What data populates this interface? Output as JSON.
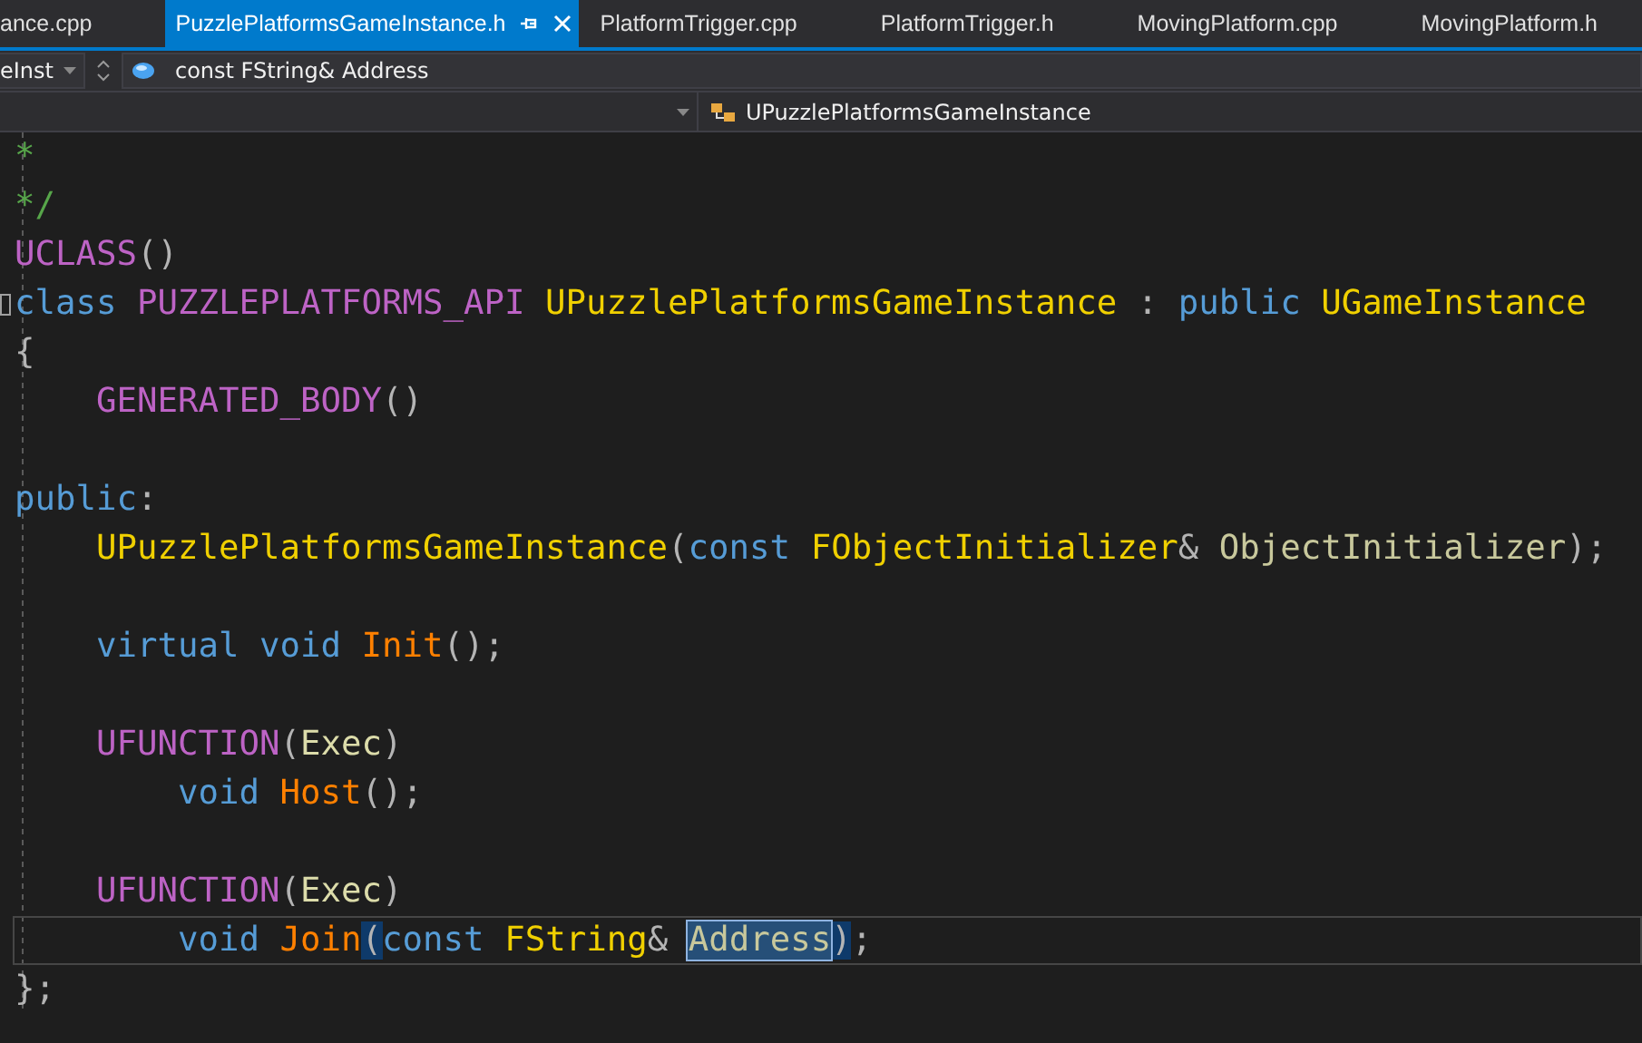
{
  "tabs": [
    {
      "label": "ance.cpp",
      "selected": false
    },
    {
      "label": "PuzzlePlatformsGameInstance.h",
      "selected": true
    },
    {
      "label": "PlatformTrigger.cpp",
      "selected": false
    },
    {
      "label": "PlatformTrigger.h",
      "selected": false
    },
    {
      "label": "MovingPlatform.cpp",
      "selected": false
    },
    {
      "label": "MovingPlatform.h",
      "selected": false
    }
  ],
  "navigation": {
    "project_dropdown": "eInst",
    "member_field": "const FString& Address",
    "scope_dropdown": "UPuzzlePlatformsGameInstance"
  },
  "lines": [
    {
      "kind": "code",
      "current": false,
      "fold": false,
      "tokens": [
        {
          "text": "*",
          "kind": "comment"
        }
      ]
    },
    {
      "kind": "code",
      "current": false,
      "fold": false,
      "tokens": [
        {
          "text": "*/",
          "kind": "comment"
        }
      ]
    },
    {
      "kind": "code",
      "current": false,
      "fold": false,
      "tokens": [
        {
          "text": "UCLASS",
          "kind": "macro"
        },
        {
          "text": "()",
          "kind": "punct"
        }
      ]
    },
    {
      "kind": "code",
      "current": false,
      "fold": true,
      "tokens": [
        {
          "text": "class ",
          "kind": "keyword"
        },
        {
          "text": "PUZZLEPLATFORMS_API ",
          "kind": "macro"
        },
        {
          "text": "UPuzzlePlatformsGameInstance ",
          "kind": "type"
        },
        {
          "text": ": ",
          "kind": "punct"
        },
        {
          "text": "public ",
          "kind": "keyword"
        },
        {
          "text": "UGameInstance",
          "kind": "type"
        }
      ]
    },
    {
      "kind": "code",
      "current": false,
      "fold": false,
      "tokens": [
        {
          "text": "{",
          "kind": "punct"
        }
      ]
    },
    {
      "kind": "code",
      "current": false,
      "fold": false,
      "tokens": [
        {
          "text": "    GENERATED_BODY",
          "kind": "macro"
        },
        {
          "text": "()",
          "kind": "punct"
        }
      ]
    },
    {
      "kind": "blank",
      "current": false,
      "fold": false
    },
    {
      "kind": "code",
      "current": false,
      "fold": false,
      "tokens": [
        {
          "text": "public",
          "kind": "keyword"
        },
        {
          "text": ":",
          "kind": "punct"
        }
      ]
    },
    {
      "kind": "code",
      "current": false,
      "fold": false,
      "tokens": [
        {
          "text": "    UPuzzlePlatformsGameInstance",
          "kind": "type"
        },
        {
          "text": "(",
          "kind": "punct"
        },
        {
          "text": "const ",
          "kind": "keyword"
        },
        {
          "text": "FObjectInitializer",
          "kind": "type"
        },
        {
          "text": "& ",
          "kind": "punct"
        },
        {
          "text": "ObjectInitializer",
          "kind": "param"
        },
        {
          "text": ");",
          "kind": "punct"
        }
      ]
    },
    {
      "kind": "blank",
      "current": false,
      "fold": false
    },
    {
      "kind": "code",
      "current": false,
      "fold": false,
      "tokens": [
        {
          "text": "    virtual void ",
          "kind": "keyword"
        },
        {
          "text": "Init",
          "kind": "function"
        },
        {
          "text": "();",
          "kind": "punct"
        }
      ]
    },
    {
      "kind": "blank",
      "current": false,
      "fold": false
    },
    {
      "kind": "code",
      "current": false,
      "fold": false,
      "tokens": [
        {
          "text": "    UFUNCTION",
          "kind": "macro"
        },
        {
          "text": "(",
          "kind": "punct"
        },
        {
          "text": "Exec",
          "kind": "argument"
        },
        {
          "text": ")",
          "kind": "punct"
        }
      ]
    },
    {
      "kind": "code",
      "current": false,
      "fold": false,
      "tokens": [
        {
          "text": "        void ",
          "kind": "keyword"
        },
        {
          "text": "Host",
          "kind": "function"
        },
        {
          "text": "();",
          "kind": "punct"
        }
      ]
    },
    {
      "kind": "blank",
      "current": false,
      "fold": false
    },
    {
      "kind": "code",
      "current": false,
      "fold": false,
      "tokens": [
        {
          "text": "    UFUNCTION",
          "kind": "macro"
        },
        {
          "text": "(",
          "kind": "punct"
        },
        {
          "text": "Exec",
          "kind": "argument"
        },
        {
          "text": ")",
          "kind": "punct"
        }
      ]
    },
    {
      "kind": "code",
      "current": true,
      "fold": false,
      "tokens": [
        {
          "text": "        void ",
          "kind": "keyword"
        },
        {
          "text": "Join",
          "kind": "function"
        },
        {
          "text": "(",
          "kind": "paren-match"
        },
        {
          "text": "const ",
          "kind": "keyword"
        },
        {
          "text": "FString",
          "kind": "type"
        },
        {
          "text": "& ",
          "kind": "punct"
        },
        {
          "text": "Address",
          "kind": "selected-param"
        },
        {
          "text": ")",
          "kind": "paren-match"
        },
        {
          "text": ";",
          "kind": "punct"
        }
      ]
    },
    {
      "kind": "code",
      "current": false,
      "fold": false,
      "tokens": [
        {
          "text": "};",
          "kind": "punct"
        }
      ]
    }
  ]
}
